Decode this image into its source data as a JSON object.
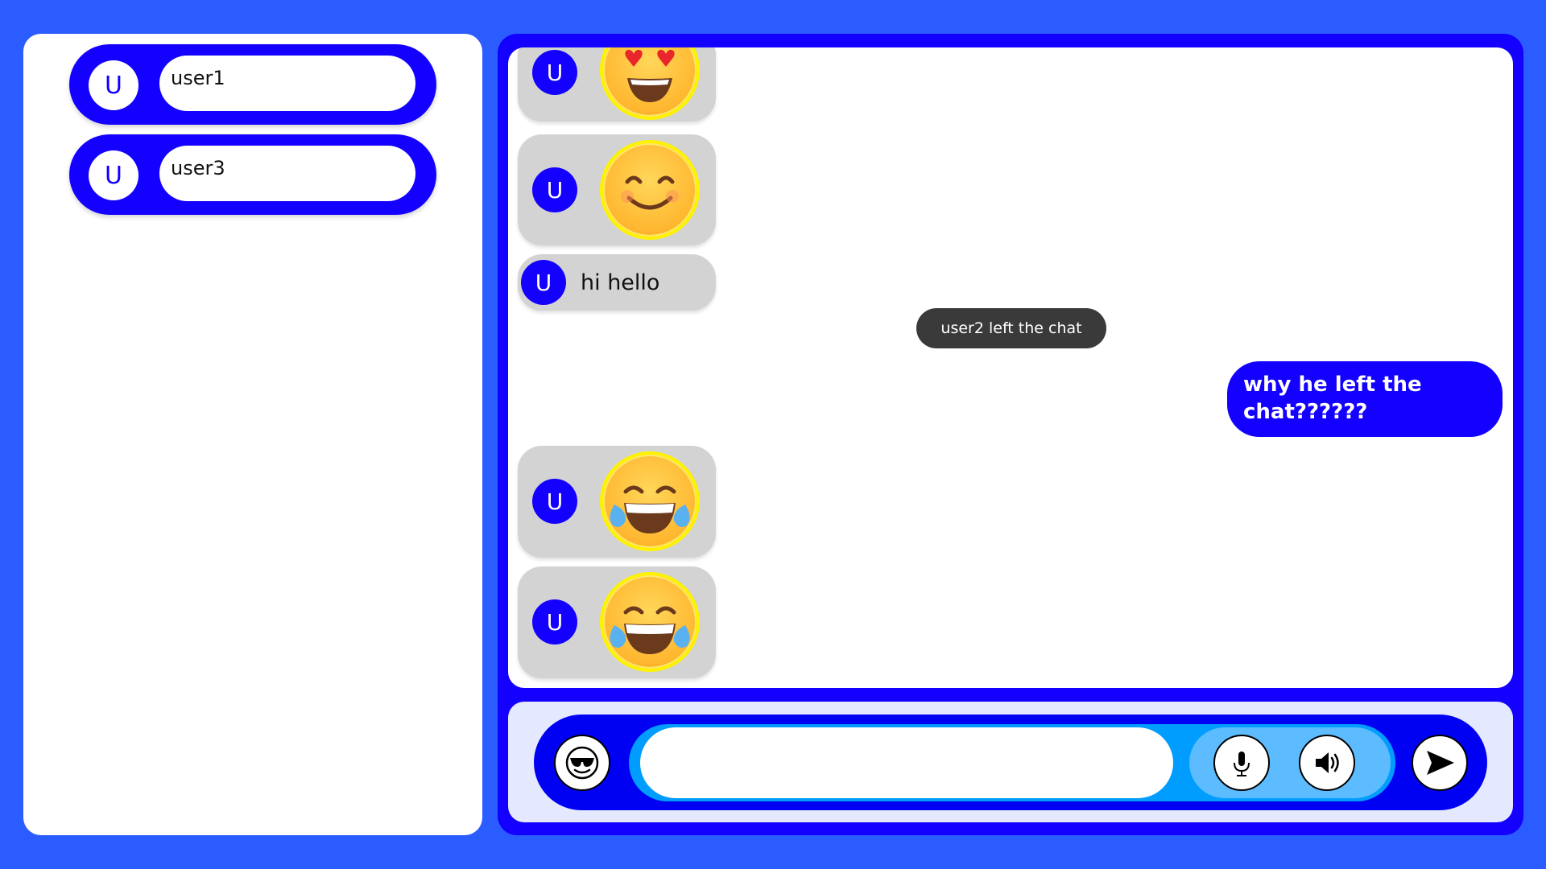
{
  "users": [
    {
      "avatar": "U",
      "name": "user1"
    },
    {
      "avatar": "U",
      "name": "user3"
    }
  ],
  "messages": [
    {
      "avatar": "U",
      "emoji": "heart-eyes-emoji"
    },
    {
      "avatar": "U",
      "emoji": "smiling-face-emoji"
    },
    {
      "avatar": "U",
      "text": "hi hello"
    },
    {
      "system": "user2 left the chat"
    },
    {
      "own_text": "why he left the chat??????"
    },
    {
      "avatar": "U",
      "emoji": "tears-of-joy-emoji"
    },
    {
      "avatar": "U",
      "emoji": "tears-of-joy-emoji"
    }
  ],
  "composer": {
    "input_value": "",
    "emoji_button_icon": "sunglasses-face-icon",
    "mic_icon": "microphone-icon",
    "speaker_icon": "speaker-icon",
    "send_icon": "send-icon"
  },
  "colors": {
    "page_background": "#2b5cff",
    "primary": "#1300ff",
    "bubble": "#d3d3d3",
    "system_note": "#3a3a3a",
    "input_track": "#009dff",
    "tool_pill": "#5cbcff"
  }
}
